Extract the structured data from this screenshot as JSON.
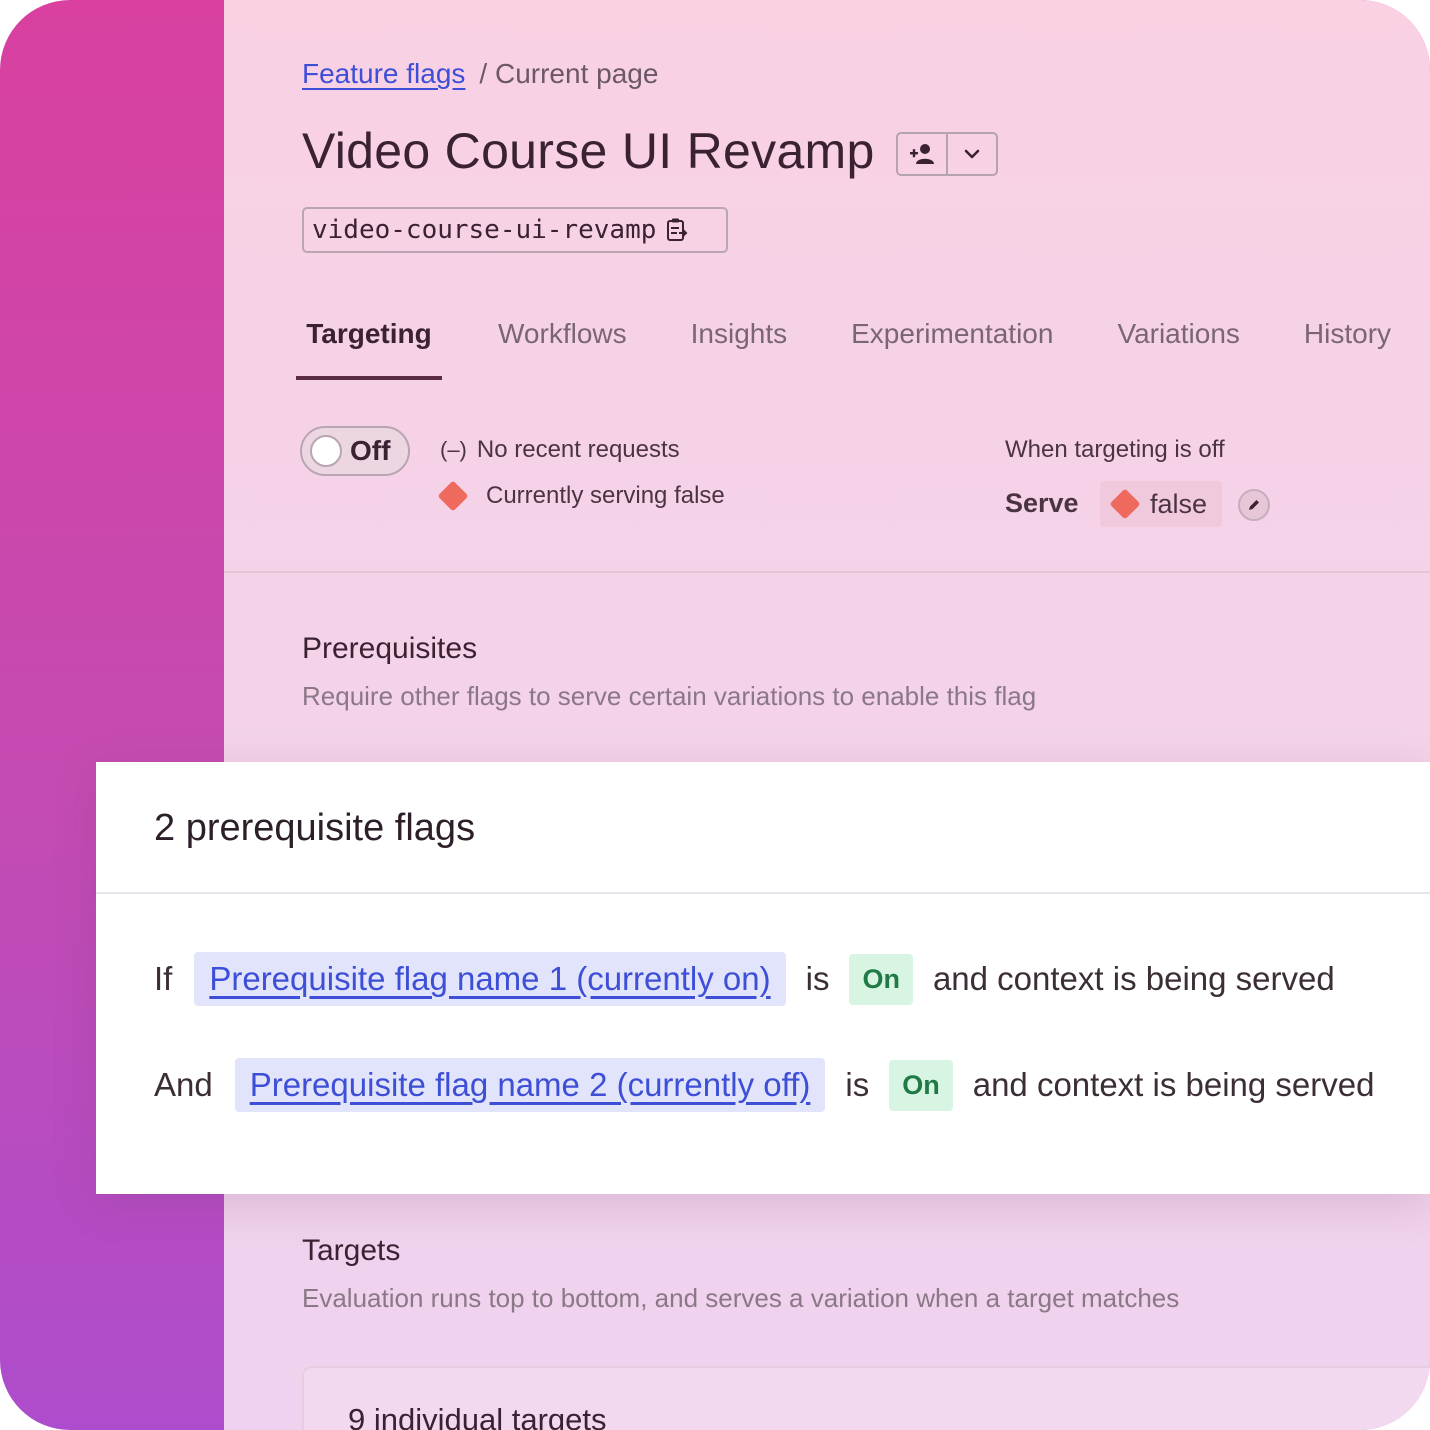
{
  "breadcrumb": {
    "link": "Feature flags",
    "current": "/ Current page"
  },
  "flag": {
    "title": "Video Course UI Revamp",
    "key": "video-course-ui-revamp"
  },
  "header_icons": {
    "follow": "add-person-icon",
    "menu": "chevron-down-icon",
    "copy": "clipboard-copy-icon"
  },
  "tabs": [
    {
      "label": "Targeting",
      "active": true
    },
    {
      "label": "Workflows"
    },
    {
      "label": "Insights"
    },
    {
      "label": "Experimentation"
    },
    {
      "label": "Variations"
    },
    {
      "label": "History"
    }
  ],
  "status": {
    "toggle_label": "Off",
    "requests_icon": "(–)",
    "requests": "No recent requests",
    "serving": "Currently serving false"
  },
  "off_serve": {
    "heading": "When targeting is off",
    "label": "Serve",
    "value": "false"
  },
  "prerequisites": {
    "heading": "Prerequisites",
    "description": "Require other flags to serve certain variations to enable this flag"
  },
  "prereq_card": {
    "title": "2 prerequisite flags",
    "rows": [
      {
        "keyword": "If",
        "flag": "Prerequisite flag name 1 (currently on)",
        "is": "is",
        "state": "On",
        "tail": "and context is being served"
      },
      {
        "keyword": "And",
        "flag": "Prerequisite flag name 2 (currently off)",
        "is": "is",
        "state": "On",
        "tail": "and context is being served"
      }
    ]
  },
  "targets": {
    "heading": "Targets",
    "description": "Evaluation runs top to bottom, and serves a variation when a target matches",
    "individual": "9 individual targets"
  },
  "colors": {
    "link": "#3d4fd6",
    "variation_false": "#ef6a5e",
    "on_badge": "#1f7a45",
    "accent_gradient_top": "#d940a0"
  }
}
